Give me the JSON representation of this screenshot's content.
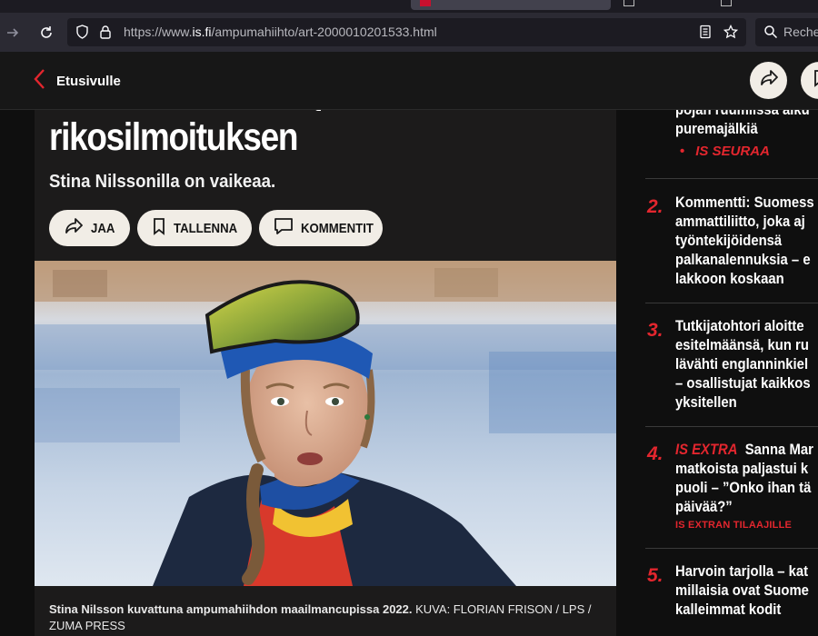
{
  "browser": {
    "url_prefix": "https://www.",
    "url_host": "is.fi",
    "url_path": "/ampumahiihto/art-2000010201533.html",
    "search_placeholder": "Recher"
  },
  "header": {
    "back_label": "Etusivulle"
  },
  "article": {
    "headline": "rikosilmoituksen",
    "lead": "Stina Nilssonilla on vaikeaa.",
    "actions": {
      "share": "JAA",
      "save": "TALLENNA",
      "comment": "KOMMENTIT"
    },
    "caption_main": "Stina Nilsson kuvattuna ampumahiihdon maailmancupissa 2022.",
    "caption_credit": " KUVA: FLORIAN FRISON / LPS / ZUMA PRESS"
  },
  "sidebar": {
    "item1": {
      "lines": [
        "pojan ruumiissa aiku",
        "puremajälkiä"
      ],
      "tag": "IS SEURAA"
    },
    "item2": {
      "rank": "2.",
      "lines": [
        "Kommentti: Suomess",
        "ammattiliitto, joka aj",
        "työntekijöidensä",
        "palkanalennuksia – e",
        "lakkoon koskaan"
      ]
    },
    "item3": {
      "rank": "3.",
      "lines": [
        "Tutkijatohtori aloitte",
        "esitelmäänsä, kun ru",
        "lävähti englanninkiel",
        "– osallistujat kaikkos",
        "yksitellen"
      ]
    },
    "item4": {
      "rank": "4.",
      "tag": "IS EXTRA",
      "lines": [
        "Sanna Mar",
        "matkoista paljastui k",
        "puoli – ”Onko ihan tä",
        "päivää?”"
      ],
      "subtag": "IS EXTRAN TILAAJILLE"
    },
    "item5": {
      "rank": "5.",
      "lines": [
        "Harvoin tarjolla – kat",
        "millaisia ovat Suome",
        "kalleimmat kodit"
      ]
    }
  },
  "colors": {
    "accent_red": "#e3262e",
    "button_bg": "#f1ede6",
    "page_bg": "#0f0f0f"
  }
}
